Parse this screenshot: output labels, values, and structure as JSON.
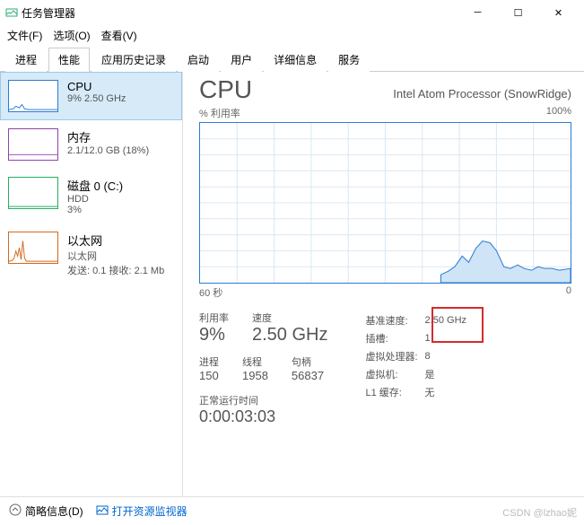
{
  "window": {
    "title": "任务管理器"
  },
  "menu": {
    "file": "文件(F)",
    "options": "选项(O)",
    "view": "查看(V)"
  },
  "tabs": [
    "进程",
    "性能",
    "应用历史记录",
    "启动",
    "用户",
    "详细信息",
    "服务"
  ],
  "sidebar": {
    "items": [
      {
        "title": "CPU",
        "sub": "9% 2.50 GHz",
        "color": "#2b7cd3"
      },
      {
        "title": "内存",
        "sub": "2.1/12.0 GB (18%)",
        "color": "#8e44ad"
      },
      {
        "title": "磁盘 0 (C:)",
        "sub1": "HDD",
        "sub2": "3%",
        "color": "#27ae60"
      },
      {
        "title": "以太网",
        "sub1": "以太网",
        "sub2": "发送: 0.1 接收: 2.1 Mb",
        "color": "#d2691e"
      }
    ]
  },
  "detail": {
    "heading": "CPU",
    "model": "Intel Atom Processor (SnowRidge)",
    "util_label": "% 利用率",
    "util_max": "100%",
    "x_left": "60 秒",
    "x_right": "0",
    "stats1": [
      {
        "lbl": "利用率",
        "val": "9%"
      },
      {
        "lbl": "速度",
        "val": "2.50 GHz"
      }
    ],
    "stats2": [
      {
        "lbl": "进程",
        "val": "150"
      },
      {
        "lbl": "线程",
        "val": "1958"
      },
      {
        "lbl": "句柄",
        "val": "56837"
      }
    ],
    "right": [
      {
        "lbl": "基准速度:",
        "val": "2.50 GHz"
      },
      {
        "lbl": "插槽:",
        "val": "1"
      },
      {
        "lbl": "虚拟处理器:",
        "val": "8"
      },
      {
        "lbl": "虚拟机:",
        "val": "是"
      },
      {
        "lbl": "L1 缓存:",
        "val": "无"
      }
    ],
    "uptime_lbl": "正常运行时间",
    "uptime_val": "0:00:03:03"
  },
  "footer": {
    "fewer": "简略信息(D)",
    "resmon": "打开资源监视器"
  },
  "watermark": "CSDN @lzhao妮",
  "chart_data": {
    "type": "area",
    "title": "% 利用率",
    "xlabel": "60 秒 → 0",
    "ylabel": "%",
    "ylim": [
      0,
      100
    ],
    "x": [
      60,
      55,
      50,
      45,
      40,
      35,
      30,
      25,
      20,
      18,
      17,
      16,
      15,
      14,
      13,
      12,
      11,
      10,
      9,
      8,
      7,
      6,
      5,
      4,
      3,
      2,
      1,
      0
    ],
    "values": [
      0,
      0,
      0,
      0,
      0,
      0,
      0,
      0,
      0,
      5,
      7,
      10,
      17,
      13,
      22,
      26,
      25,
      20,
      10,
      9,
      11,
      9,
      8,
      10,
      9,
      9,
      8,
      9
    ]
  }
}
